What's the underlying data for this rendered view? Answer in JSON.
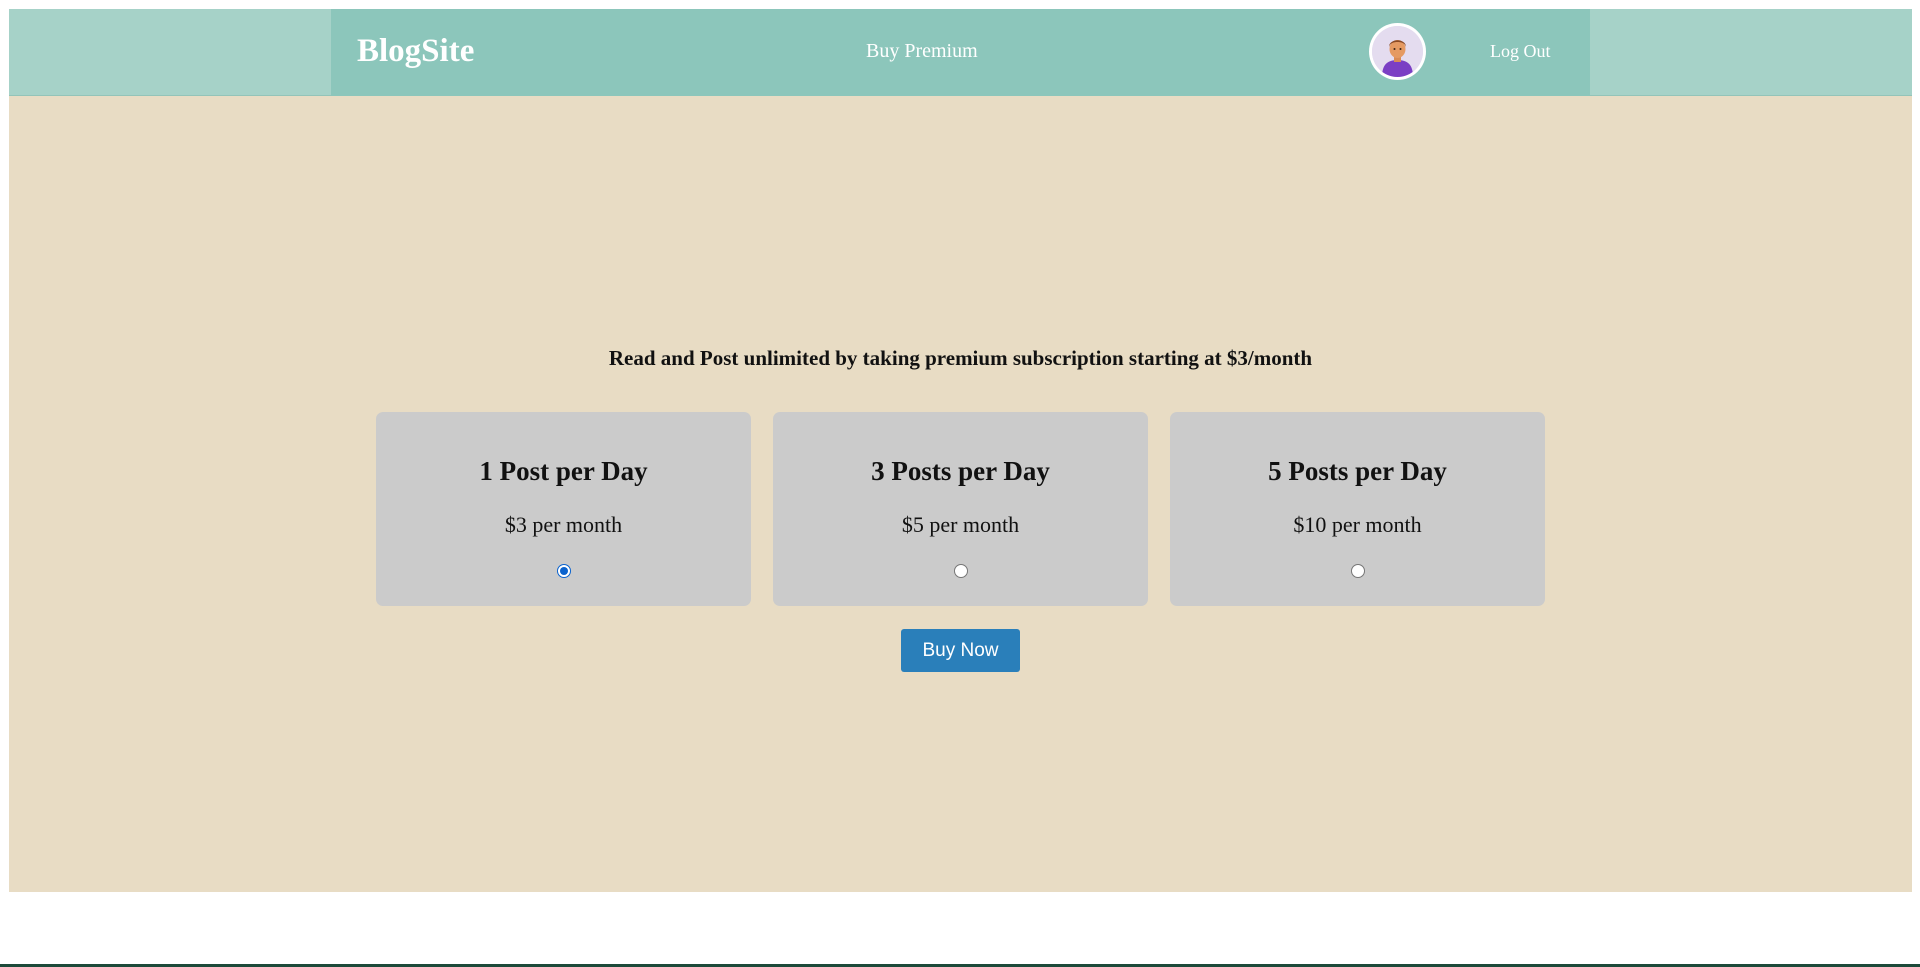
{
  "header": {
    "brand": "BlogSite",
    "nav_premium": "Buy Premium",
    "logout": "Log Out",
    "avatar_icon": "user-avatar-icon"
  },
  "main": {
    "headline": "Read and Post unlimited by taking premium subscription starting at $3/month",
    "plans": [
      {
        "title": "1 Post per Day",
        "price": "$3 per month",
        "selected": true
      },
      {
        "title": "3 Posts per Day",
        "price": "$5 per month",
        "selected": false
      },
      {
        "title": "5 Posts per Day",
        "price": "$10 per month",
        "selected": false
      }
    ],
    "buy_button": "Buy Now"
  },
  "colors": {
    "navbar": "#8cc6bb",
    "page_background": "#e8dcc4",
    "card": "#cbcbcb",
    "button": "#2a7fba"
  }
}
